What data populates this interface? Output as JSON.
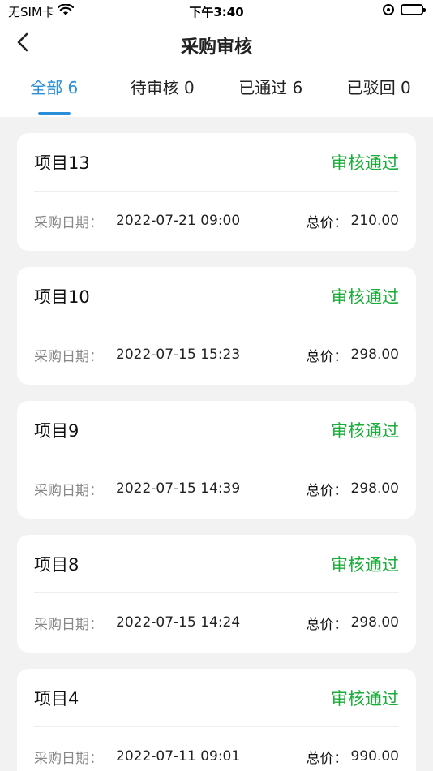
{
  "status_bar": {
    "carrier": "无SIM卡",
    "time": "下午3:40"
  },
  "nav": {
    "title": "采购审核"
  },
  "tabs": [
    {
      "label": "全部 6",
      "active": true
    },
    {
      "label": "待审核 0",
      "active": false
    },
    {
      "label": "已通过 6",
      "active": false
    },
    {
      "label": "已驳回 0",
      "active": false
    }
  ],
  "date_label": "采购日期：",
  "price_label": "总价：",
  "status_color": "#1aad3a",
  "accent_color": "#2a8fd9",
  "items": [
    {
      "name": "项目13",
      "status": "审核通过",
      "date": "2022-07-21 09:00",
      "price": "210.00"
    },
    {
      "name": "项目10",
      "status": "审核通过",
      "date": "2022-07-15 15:23",
      "price": "298.00"
    },
    {
      "name": "项目9",
      "status": "审核通过",
      "date": "2022-07-15 14:39",
      "price": "298.00"
    },
    {
      "name": "项目8",
      "status": "审核通过",
      "date": "2022-07-15 14:24",
      "price": "298.00"
    },
    {
      "name": "项目4",
      "status": "审核通过",
      "date": "2022-07-11 09:01",
      "price": "990.00"
    }
  ]
}
